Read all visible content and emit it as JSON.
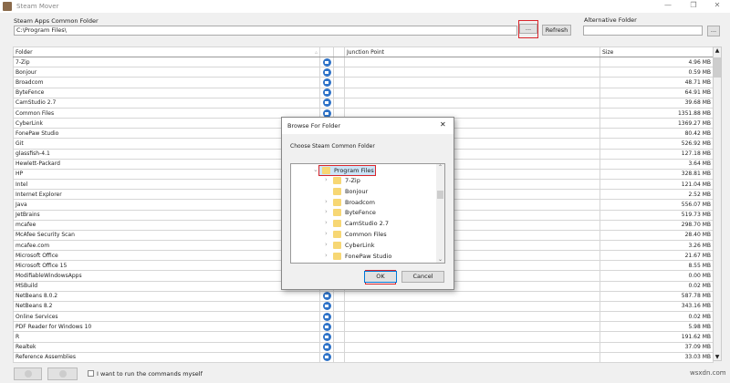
{
  "window": {
    "title": "Steam Mover",
    "minimize": "—",
    "restore": "❐",
    "close": "✕"
  },
  "common": {
    "label": "Steam Apps Common Folder",
    "value": "C:\\Program Files\\",
    "browse": "...",
    "refresh": "Refresh"
  },
  "alternative": {
    "label": "Alternative Folder",
    "value": "",
    "browse": "..."
  },
  "table": {
    "headers": {
      "folder": "Folder",
      "junction": "Junction Point",
      "size": "Size"
    },
    "rows": [
      [
        "7-Zip",
        "4.96 MB"
      ],
      [
        "Bonjour",
        "0.59 MB"
      ],
      [
        "Broadcom",
        "48.71 MB"
      ],
      [
        "ByteFence",
        "64.91 MB"
      ],
      [
        "CamStudio 2.7",
        "39.68 MB"
      ],
      [
        "Common Files",
        "1351.88 MB"
      ],
      [
        "CyberLink",
        "1369.27 MB"
      ],
      [
        "FonePaw Studio",
        "80.42 MB"
      ],
      [
        "Git",
        "526.92 MB"
      ],
      [
        "glassfish-4.1",
        "127.18 MB"
      ],
      [
        "Hewlett-Packard",
        "3.64 MB"
      ],
      [
        "HP",
        "328.81 MB"
      ],
      [
        "Intel",
        "121.04 MB"
      ],
      [
        "Internet Explorer",
        "2.52 MB"
      ],
      [
        "Java",
        "556.07 MB"
      ],
      [
        "JetBrains",
        "519.73 MB"
      ],
      [
        "mcafee",
        "298.70 MB"
      ],
      [
        "McAfee Security Scan",
        "28.40 MB"
      ],
      [
        "mcafee.com",
        "3.26 MB"
      ],
      [
        "Microsoft Office",
        "21.67 MB"
      ],
      [
        "Microsoft Office 15",
        "8.55 MB"
      ],
      [
        "ModifiableWindowsApps",
        "0.00 MB"
      ],
      [
        "MSBuild",
        "0.02 MB"
      ],
      [
        "NetBeans 8.0.2",
        "587.78 MB"
      ],
      [
        "NetBeans 8.2",
        "343.16 MB"
      ],
      [
        "Online Services",
        "0.02 MB"
      ],
      [
        "PDF Reader for Windows 10",
        "5.98 MB"
      ],
      [
        "R",
        "191.62 MB"
      ],
      [
        "Realtek",
        "37.09 MB"
      ],
      [
        "Reference Assemblies",
        "33.03 MB"
      ]
    ]
  },
  "dialog": {
    "title": "Browse For Folder",
    "close": "✕",
    "prompt": "Choose Steam Common Folder",
    "root": "Program Files",
    "items": [
      "7-Zip",
      "Bonjour",
      "Broadcom",
      "ByteFence",
      "CamStudio 2.7",
      "Common Files",
      "CyberLink",
      "FonePaw Studio"
    ],
    "expandable": [
      true,
      false,
      true,
      true,
      true,
      true,
      true,
      true
    ],
    "ok": "OK",
    "cancel": "Cancel"
  },
  "footer": {
    "checkbox_label": "I want to run the commands myself",
    "checked": false
  },
  "watermark": "wsxdn.com"
}
